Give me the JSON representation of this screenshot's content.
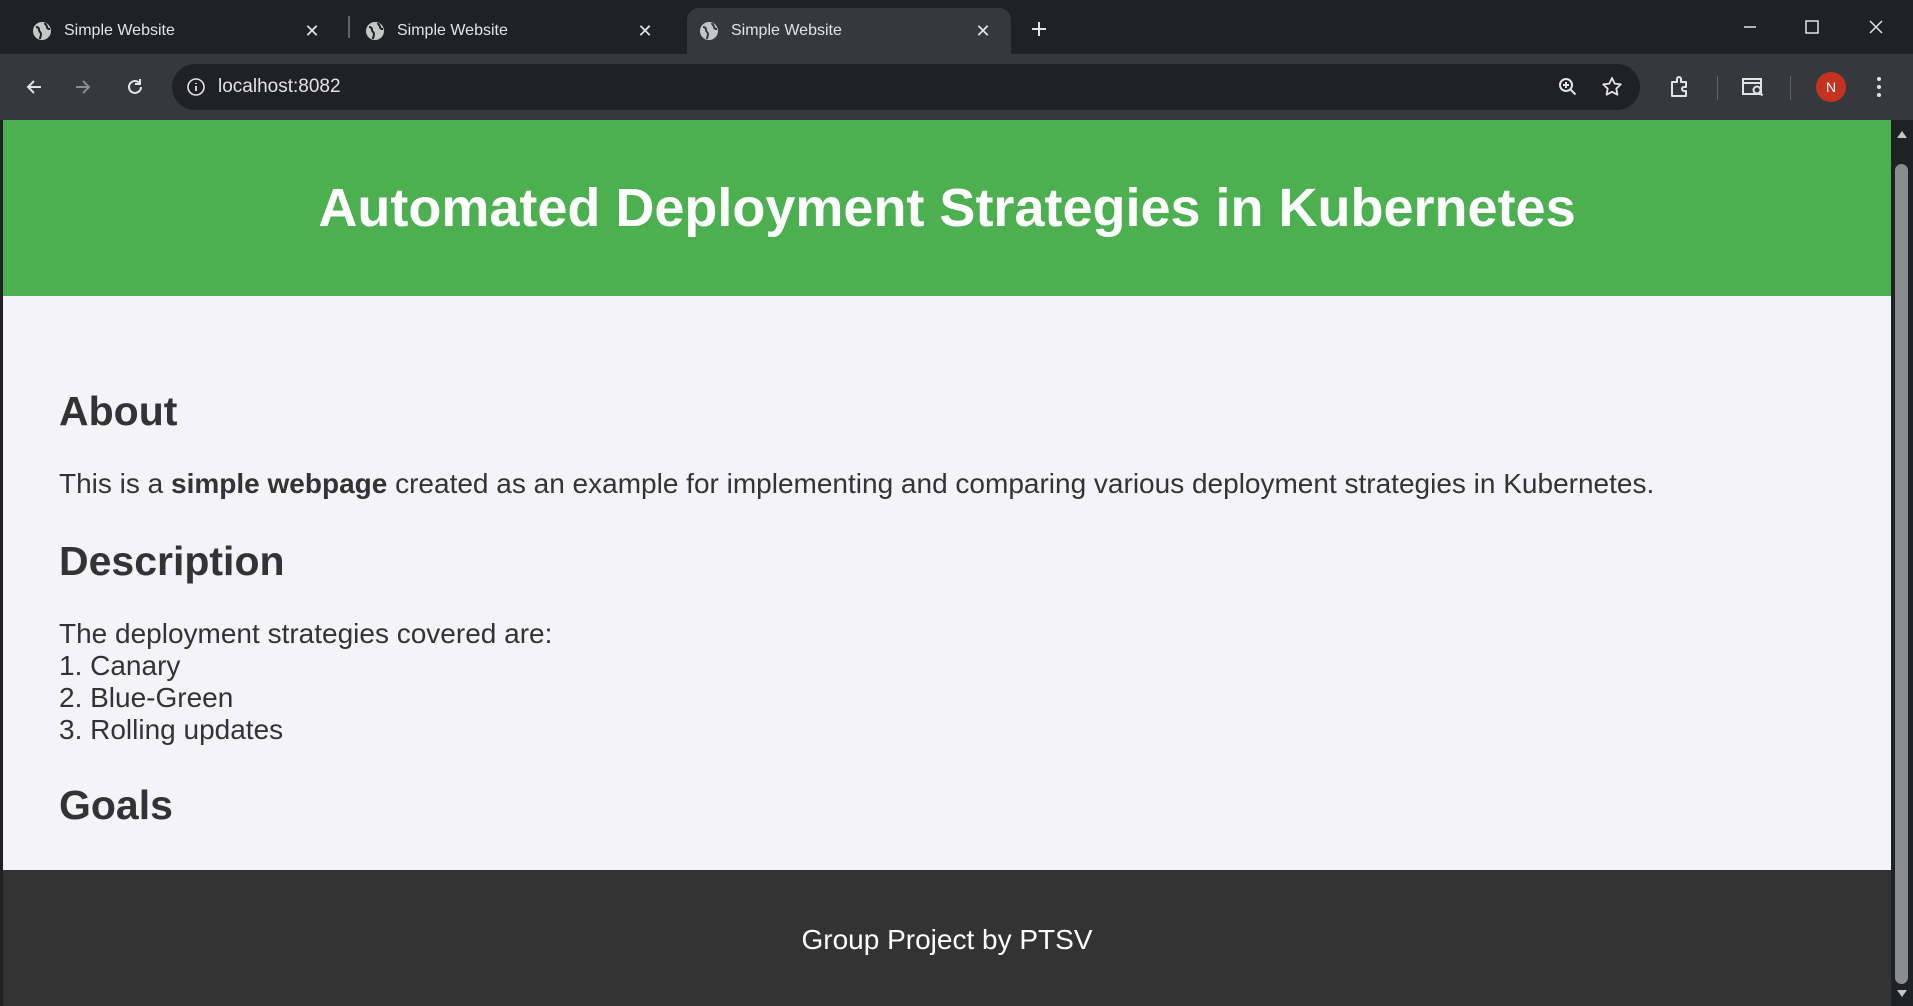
{
  "browser": {
    "tabs": [
      {
        "title": "Simple Website",
        "active": false
      },
      {
        "title": "Simple Website",
        "active": false
      },
      {
        "title": "Simple Website",
        "active": true
      }
    ],
    "url": "localhost:8082",
    "profile_initial": "N",
    "icons": [
      "globe-icon",
      "close-icon",
      "new-tab-icon",
      "minimize-icon",
      "maximize-icon",
      "window-close-icon",
      "back-icon",
      "forward-icon",
      "reload-icon",
      "info-icon",
      "zoom-icon",
      "star-icon",
      "extensions-icon",
      "search-panel-icon",
      "menu-icon"
    ],
    "colors": {
      "chrome_dark": "#1f2224",
      "chrome_toolbar": "#35393d",
      "avatar": "#c5331e"
    }
  },
  "page": {
    "header_title": "Automated Deployment Strategies in Kubernetes",
    "about": {
      "heading": "About",
      "text_before": "This is a ",
      "text_bold": "simple webpage",
      "text_after": " created as an example for implementing and comparing various deployment strategies in Kubernetes."
    },
    "description": {
      "heading": "Description",
      "intro": "The deployment strategies covered are:",
      "items": [
        "1. Canary",
        "2. Blue-Green",
        "3. Rolling updates"
      ]
    },
    "goals": {
      "heading": "Goals"
    },
    "footer_text": "Group Project by PTSV",
    "colors": {
      "header_bg": "#4caf50",
      "page_bg": "#f4f4f8",
      "footer_bg": "#333333",
      "text": "#333333"
    }
  }
}
